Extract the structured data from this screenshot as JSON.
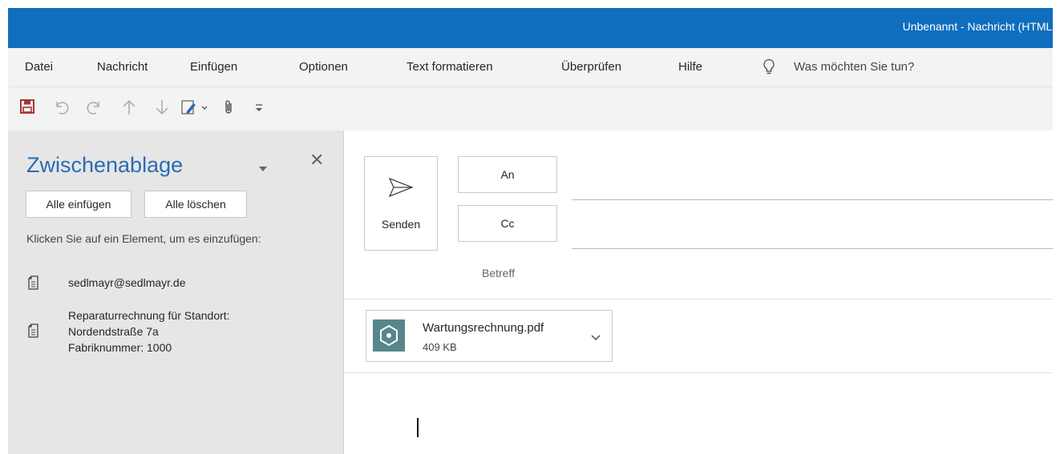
{
  "window": {
    "title": "Unbenannt  -  Nachricht (HTML)"
  },
  "menu": {
    "items": [
      "Datei",
      "Nachricht",
      "Einfügen",
      "Optionen",
      "Text formatieren",
      "Überprüfen",
      "Hilfe"
    ],
    "tell_me": "Was möchten Sie tun?"
  },
  "quick_access": {
    "icons": [
      "save-icon",
      "undo-icon",
      "redo-icon",
      "up-arrow-icon",
      "down-arrow-icon",
      "signature-icon",
      "attach-icon",
      "customize-icon"
    ]
  },
  "clipboard": {
    "title": "Zwischenablage",
    "paste_all": "Alle einfügen",
    "clear_all": "Alle löschen",
    "hint": "Klicken Sie auf ein Element, um es einzufügen:",
    "items": [
      {
        "lines": [
          "sedlmayr@sedlmayr.de"
        ]
      },
      {
        "lines": [
          "Reparaturrechnung für Standort:",
          "Nordendstraße 7a",
          "Fabriknummer: 1000"
        ]
      }
    ]
  },
  "compose": {
    "send_label": "Senden",
    "to_label": "An",
    "cc_label": "Cc",
    "subject_label": "Betreff",
    "to_value": "",
    "cc_value": "",
    "attachment": {
      "name": "Wartungsrechnung.pdf",
      "size": "409 KB"
    },
    "colors": {
      "accent": "#106ebe",
      "clipboard_title": "#2b6cb3",
      "save_icon": "#a4373a",
      "attachment_icon": "#58868a"
    }
  }
}
